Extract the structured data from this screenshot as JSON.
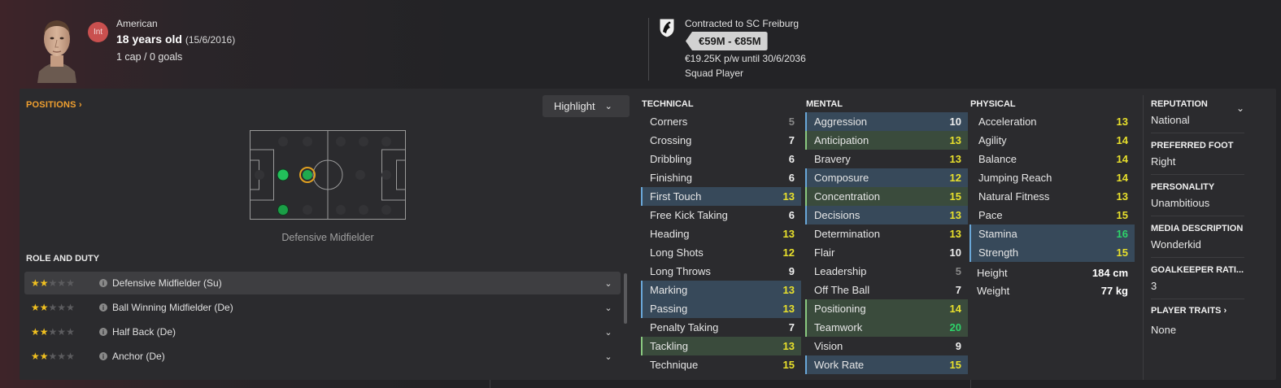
{
  "header": {
    "intl_badge": "Int",
    "nationality": "American",
    "age": "18 years old",
    "dob": "(15/6/2016)",
    "caps": "1 cap / 0 goals",
    "contract": "Contracted to SC Freiburg",
    "value": "€59M - €85M",
    "wage": "€19.25K p/w until 30/6/2036",
    "squad_status": "Squad Player"
  },
  "positions": {
    "title": "POSITIONS",
    "highlight_label": "Highlight",
    "caption": "Defensive Midfielder"
  },
  "roles": {
    "title": "ROLE AND DUTY",
    "items": [
      {
        "name": "Defensive Midfielder (Su)",
        "stars": 2
      },
      {
        "name": "Ball Winning Midfielder (De)",
        "stars": 2
      },
      {
        "name": "Half Back (De)",
        "stars": 2
      },
      {
        "name": "Anchor (De)",
        "stars": 2
      }
    ]
  },
  "technical": {
    "title": "TECHNICAL",
    "items": [
      {
        "name": "Corners",
        "value": "5",
        "hl": ""
      },
      {
        "name": "Crossing",
        "value": "7",
        "hl": ""
      },
      {
        "name": "Dribbling",
        "value": "6",
        "hl": ""
      },
      {
        "name": "Finishing",
        "value": "6",
        "hl": ""
      },
      {
        "name": "First Touch",
        "value": "13",
        "hl": "blue"
      },
      {
        "name": "Free Kick Taking",
        "value": "6",
        "hl": ""
      },
      {
        "name": "Heading",
        "value": "13",
        "hl": ""
      },
      {
        "name": "Long Shots",
        "value": "12",
        "hl": ""
      },
      {
        "name": "Long Throws",
        "value": "9",
        "hl": ""
      },
      {
        "name": "Marking",
        "value": "13",
        "hl": "blue"
      },
      {
        "name": "Passing",
        "value": "13",
        "hl": "blue"
      },
      {
        "name": "Penalty Taking",
        "value": "7",
        "hl": ""
      },
      {
        "name": "Tackling",
        "value": "13",
        "hl": "green"
      },
      {
        "name": "Technique",
        "value": "15",
        "hl": ""
      }
    ]
  },
  "mental": {
    "title": "MENTAL",
    "items": [
      {
        "name": "Aggression",
        "value": "10",
        "hl": "blue"
      },
      {
        "name": "Anticipation",
        "value": "13",
        "hl": "green"
      },
      {
        "name": "Bravery",
        "value": "13",
        "hl": ""
      },
      {
        "name": "Composure",
        "value": "12",
        "hl": "blue"
      },
      {
        "name": "Concentration",
        "value": "15",
        "hl": "green"
      },
      {
        "name": "Decisions",
        "value": "13",
        "hl": "blue"
      },
      {
        "name": "Determination",
        "value": "13",
        "hl": ""
      },
      {
        "name": "Flair",
        "value": "10",
        "hl": ""
      },
      {
        "name": "Leadership",
        "value": "5",
        "hl": ""
      },
      {
        "name": "Off The Ball",
        "value": "7",
        "hl": ""
      },
      {
        "name": "Positioning",
        "value": "14",
        "hl": "green"
      },
      {
        "name": "Teamwork",
        "value": "20",
        "hl": "green"
      },
      {
        "name": "Vision",
        "value": "9",
        "hl": ""
      },
      {
        "name": "Work Rate",
        "value": "15",
        "hl": "blue"
      }
    ]
  },
  "physical": {
    "title": "PHYSICAL",
    "items": [
      {
        "name": "Acceleration",
        "value": "13",
        "hl": ""
      },
      {
        "name": "Agility",
        "value": "14",
        "hl": ""
      },
      {
        "name": "Balance",
        "value": "14",
        "hl": ""
      },
      {
        "name": "Jumping Reach",
        "value": "14",
        "hl": ""
      },
      {
        "name": "Natural Fitness",
        "value": "13",
        "hl": ""
      },
      {
        "name": "Pace",
        "value": "15",
        "hl": ""
      },
      {
        "name": "Stamina",
        "value": "16",
        "hl": "blue"
      },
      {
        "name": "Strength",
        "value": "15",
        "hl": "blue"
      }
    ],
    "height_label": "Height",
    "height": "184 cm",
    "weight_label": "Weight",
    "weight": "77 kg"
  },
  "info": {
    "reputation_label": "REPUTATION",
    "reputation": "National",
    "foot_label": "PREFERRED FOOT",
    "foot": "Right",
    "personality_label": "PERSONALITY",
    "personality": "Unambitious",
    "media_label": "MEDIA DESCRIPTION",
    "media": "Wonderkid",
    "gk_label": "GOALKEEPER RATI...",
    "gk": "3",
    "traits_label": "PLAYER TRAITS",
    "traits": "None"
  },
  "colors": {
    "accent_orange": "#f0a030",
    "blue_highlight": "#37495a",
    "green_highlight": "#3a4b3c",
    "star": "#f0c020",
    "value_yellow": "#e8e02c",
    "value_green": "#2ed46a"
  }
}
